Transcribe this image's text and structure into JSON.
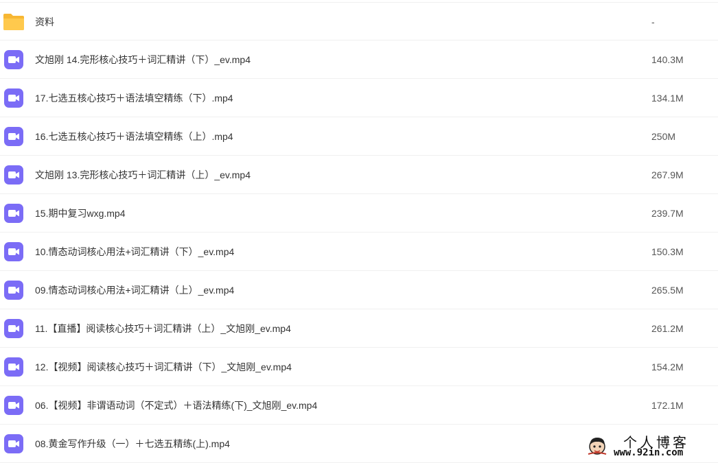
{
  "colors": {
    "folder_icon": "#ffc94d",
    "video_icon": "#7b6cf6",
    "row_border": "#f0f0f0"
  },
  "files": [
    {
      "icon": "folder-icon",
      "name": "资料",
      "size": "-"
    },
    {
      "icon": "video-icon",
      "name": "文旭刚 14.完形核心技巧＋词汇精讲（下）_ev.mp4",
      "size": "140.3M"
    },
    {
      "icon": "video-icon",
      "name": "17.七选五核心技巧＋语法填空精练（下）.mp4",
      "size": "134.1M"
    },
    {
      "icon": "video-icon",
      "name": "16.七选五核心技巧＋语法填空精练（上）.mp4",
      "size": "250M"
    },
    {
      "icon": "video-icon",
      "name": "文旭刚 13.完形核心技巧＋词汇精讲（上）_ev.mp4",
      "size": "267.9M"
    },
    {
      "icon": "video-icon",
      "name": "15.期中复习wxg.mp4",
      "size": "239.7M"
    },
    {
      "icon": "video-icon",
      "name": "10.情态动词核心用法+词汇精讲（下）_ev.mp4",
      "size": "150.3M"
    },
    {
      "icon": "video-icon",
      "name": "09.情态动词核心用法+词汇精讲（上）_ev.mp4",
      "size": "265.5M"
    },
    {
      "icon": "video-icon",
      "name": "11.【直播】阅读核心技巧＋词汇精讲（上）_文旭刚_ev.mp4",
      "size": "261.2M"
    },
    {
      "icon": "video-icon",
      "name": "12.【视频】阅读核心技巧＋词汇精讲（下）_文旭刚_ev.mp4",
      "size": "154.2M"
    },
    {
      "icon": "video-icon",
      "name": "06.【视频】非谓语动词（不定式）＋语法精练(下)_文旭刚_ev.mp4",
      "size": "172.1M"
    },
    {
      "icon": "video-icon",
      "name": "08.黄金写作升级（一）＋七选五精练(上).mp4",
      "size": ""
    }
  ],
  "watermark": {
    "title": "个人博客",
    "url": "www.92in.com"
  }
}
